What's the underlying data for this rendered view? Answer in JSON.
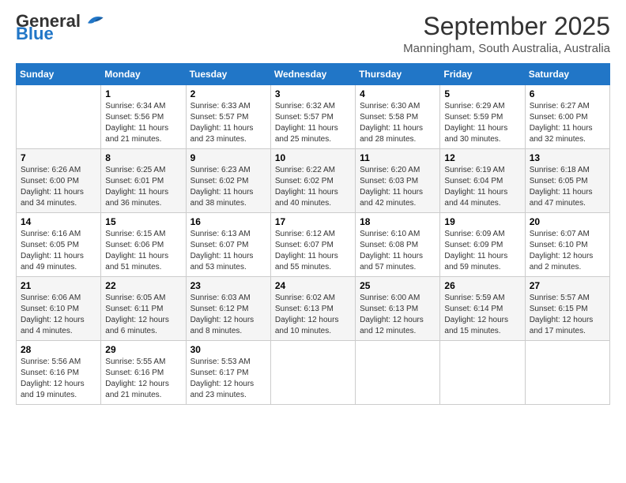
{
  "logo": {
    "line1": "General",
    "line2": "Blue"
  },
  "title": "September 2025",
  "subtitle": "Manningham, South Australia, Australia",
  "days_of_week": [
    "Sunday",
    "Monday",
    "Tuesday",
    "Wednesday",
    "Thursday",
    "Friday",
    "Saturday"
  ],
  "weeks": [
    [
      {
        "day": "",
        "empty": true
      },
      {
        "day": "1",
        "sunrise": "6:34 AM",
        "sunset": "5:56 PM",
        "daylight": "11 hours and 21 minutes."
      },
      {
        "day": "2",
        "sunrise": "6:33 AM",
        "sunset": "5:57 PM",
        "daylight": "11 hours and 23 minutes."
      },
      {
        "day": "3",
        "sunrise": "6:32 AM",
        "sunset": "5:57 PM",
        "daylight": "11 hours and 25 minutes."
      },
      {
        "day": "4",
        "sunrise": "6:30 AM",
        "sunset": "5:58 PM",
        "daylight": "11 hours and 28 minutes."
      },
      {
        "day": "5",
        "sunrise": "6:29 AM",
        "sunset": "5:59 PM",
        "daylight": "11 hours and 30 minutes."
      },
      {
        "day": "6",
        "sunrise": "6:27 AM",
        "sunset": "6:00 PM",
        "daylight": "11 hours and 32 minutes."
      }
    ],
    [
      {
        "day": "7",
        "sunrise": "6:26 AM",
        "sunset": "6:00 PM",
        "daylight": "11 hours and 34 minutes."
      },
      {
        "day": "8",
        "sunrise": "6:25 AM",
        "sunset": "6:01 PM",
        "daylight": "11 hours and 36 minutes."
      },
      {
        "day": "9",
        "sunrise": "6:23 AM",
        "sunset": "6:02 PM",
        "daylight": "11 hours and 38 minutes."
      },
      {
        "day": "10",
        "sunrise": "6:22 AM",
        "sunset": "6:02 PM",
        "daylight": "11 hours and 40 minutes."
      },
      {
        "day": "11",
        "sunrise": "6:20 AM",
        "sunset": "6:03 PM",
        "daylight": "11 hours and 42 minutes."
      },
      {
        "day": "12",
        "sunrise": "6:19 AM",
        "sunset": "6:04 PM",
        "daylight": "11 hours and 44 minutes."
      },
      {
        "day": "13",
        "sunrise": "6:18 AM",
        "sunset": "6:05 PM",
        "daylight": "11 hours and 47 minutes."
      }
    ],
    [
      {
        "day": "14",
        "sunrise": "6:16 AM",
        "sunset": "6:05 PM",
        "daylight": "11 hours and 49 minutes."
      },
      {
        "day": "15",
        "sunrise": "6:15 AM",
        "sunset": "6:06 PM",
        "daylight": "11 hours and 51 minutes."
      },
      {
        "day": "16",
        "sunrise": "6:13 AM",
        "sunset": "6:07 PM",
        "daylight": "11 hours and 53 minutes."
      },
      {
        "day": "17",
        "sunrise": "6:12 AM",
        "sunset": "6:07 PM",
        "daylight": "11 hours and 55 minutes."
      },
      {
        "day": "18",
        "sunrise": "6:10 AM",
        "sunset": "6:08 PM",
        "daylight": "11 hours and 57 minutes."
      },
      {
        "day": "19",
        "sunrise": "6:09 AM",
        "sunset": "6:09 PM",
        "daylight": "11 hours and 59 minutes."
      },
      {
        "day": "20",
        "sunrise": "6:07 AM",
        "sunset": "6:10 PM",
        "daylight": "12 hours and 2 minutes."
      }
    ],
    [
      {
        "day": "21",
        "sunrise": "6:06 AM",
        "sunset": "6:10 PM",
        "daylight": "12 hours and 4 minutes."
      },
      {
        "day": "22",
        "sunrise": "6:05 AM",
        "sunset": "6:11 PM",
        "daylight": "12 hours and 6 minutes."
      },
      {
        "day": "23",
        "sunrise": "6:03 AM",
        "sunset": "6:12 PM",
        "daylight": "12 hours and 8 minutes."
      },
      {
        "day": "24",
        "sunrise": "6:02 AM",
        "sunset": "6:13 PM",
        "daylight": "12 hours and 10 minutes."
      },
      {
        "day": "25",
        "sunrise": "6:00 AM",
        "sunset": "6:13 PM",
        "daylight": "12 hours and 12 minutes."
      },
      {
        "day": "26",
        "sunrise": "5:59 AM",
        "sunset": "6:14 PM",
        "daylight": "12 hours and 15 minutes."
      },
      {
        "day": "27",
        "sunrise": "5:57 AM",
        "sunset": "6:15 PM",
        "daylight": "12 hours and 17 minutes."
      }
    ],
    [
      {
        "day": "28",
        "sunrise": "5:56 AM",
        "sunset": "6:16 PM",
        "daylight": "12 hours and 19 minutes."
      },
      {
        "day": "29",
        "sunrise": "5:55 AM",
        "sunset": "6:16 PM",
        "daylight": "12 hours and 21 minutes."
      },
      {
        "day": "30",
        "sunrise": "5:53 AM",
        "sunset": "6:17 PM",
        "daylight": "12 hours and 23 minutes."
      },
      {
        "day": "",
        "empty": true
      },
      {
        "day": "",
        "empty": true
      },
      {
        "day": "",
        "empty": true
      },
      {
        "day": "",
        "empty": true
      }
    ]
  ]
}
